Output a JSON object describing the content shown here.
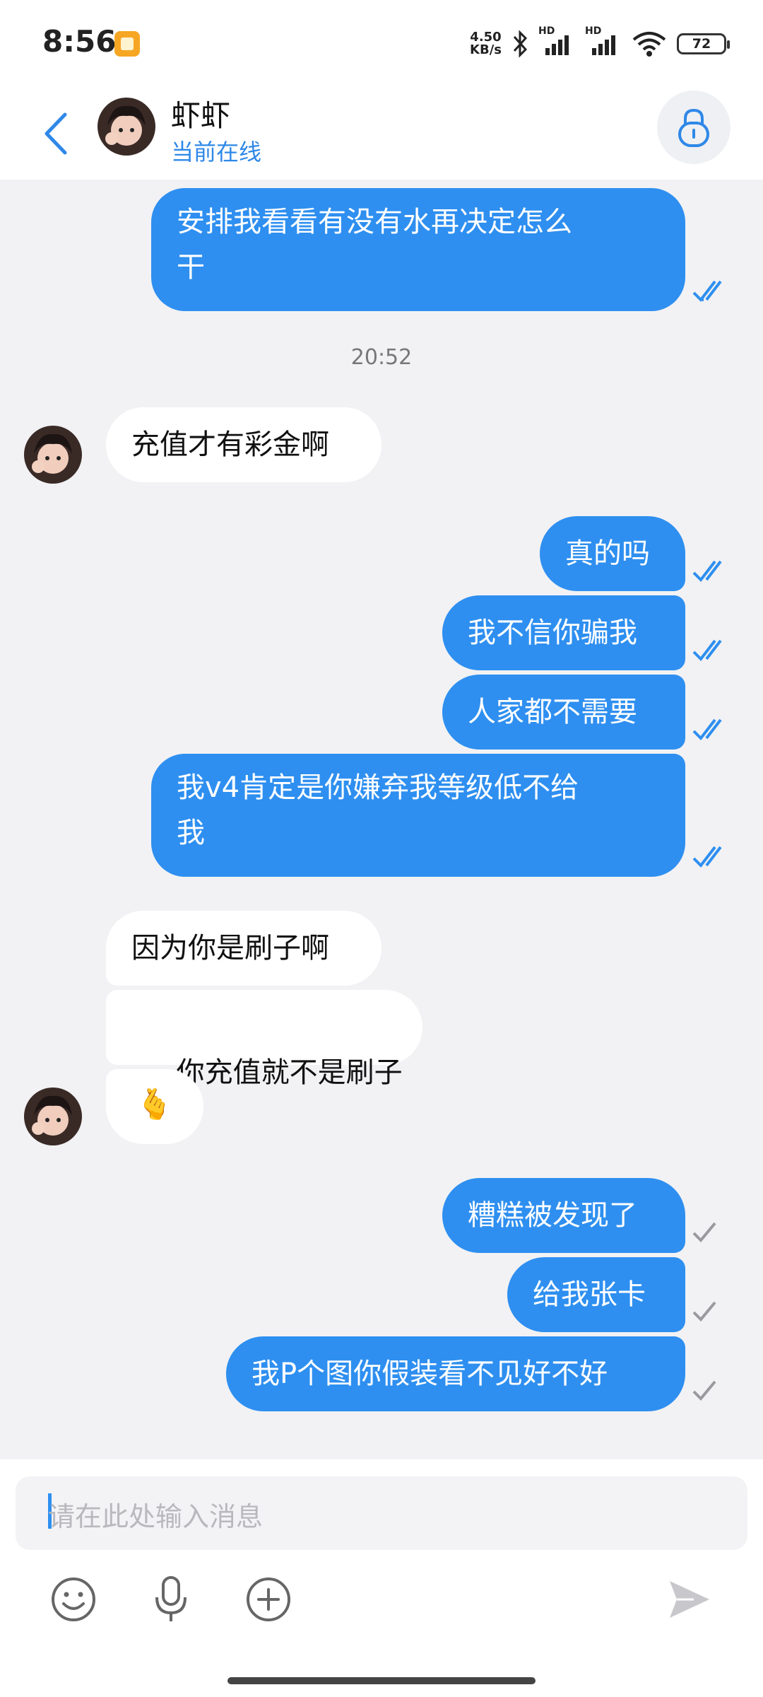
{
  "status_bar": {
    "time": "8:56",
    "speed_value": "4.50",
    "speed_unit": "KB/s",
    "signal1_label": "HD",
    "signal2_label": "HD",
    "battery": "72"
  },
  "header": {
    "contact_name": "虾虾",
    "contact_status": "当前在线"
  },
  "messages": {
    "m1": {
      "text": "安排我看看有没有水再决定怎么干",
      "line1": "安排我看看有没有水再决定怎么",
      "line2": "干",
      "status": "read"
    },
    "timestamp": "20:52",
    "m2": {
      "text": "充值才有彩金啊"
    },
    "m3": {
      "text": "真的吗",
      "status": "read"
    },
    "m4": {
      "text": "我不信你骗我",
      "status": "read"
    },
    "m5": {
      "text": "人家都不需要",
      "status": "read"
    },
    "m6": {
      "text": "我v4肯定是你嫌弃我等级低不给我",
      "line1": "我v4肯定是你嫌弃我等级低不给",
      "line2": "我",
      "status": "read"
    },
    "m7": {
      "text": "因为你是刷子啊"
    },
    "m8": {
      "text": " 你充值就不是刷子"
    },
    "m9": {
      "text": "🫰"
    },
    "m10": {
      "text": "糟糕被发现了",
      "status": "sent"
    },
    "m11": {
      "text": "给我张卡",
      "status": "sent"
    },
    "m12": {
      "text": "我P个图你假装看不见好不好",
      "status": "sent"
    }
  },
  "composer": {
    "placeholder": "请在此处输入消息",
    "icons": [
      "emoji-icon",
      "microphone-icon",
      "plus-icon",
      "send-icon"
    ]
  },
  "colors": {
    "outgoing_bubble": "#2e8ff0",
    "incoming_bubble": "#ffffff",
    "accent": "#2f88e8",
    "background": "#f2f2f4"
  }
}
